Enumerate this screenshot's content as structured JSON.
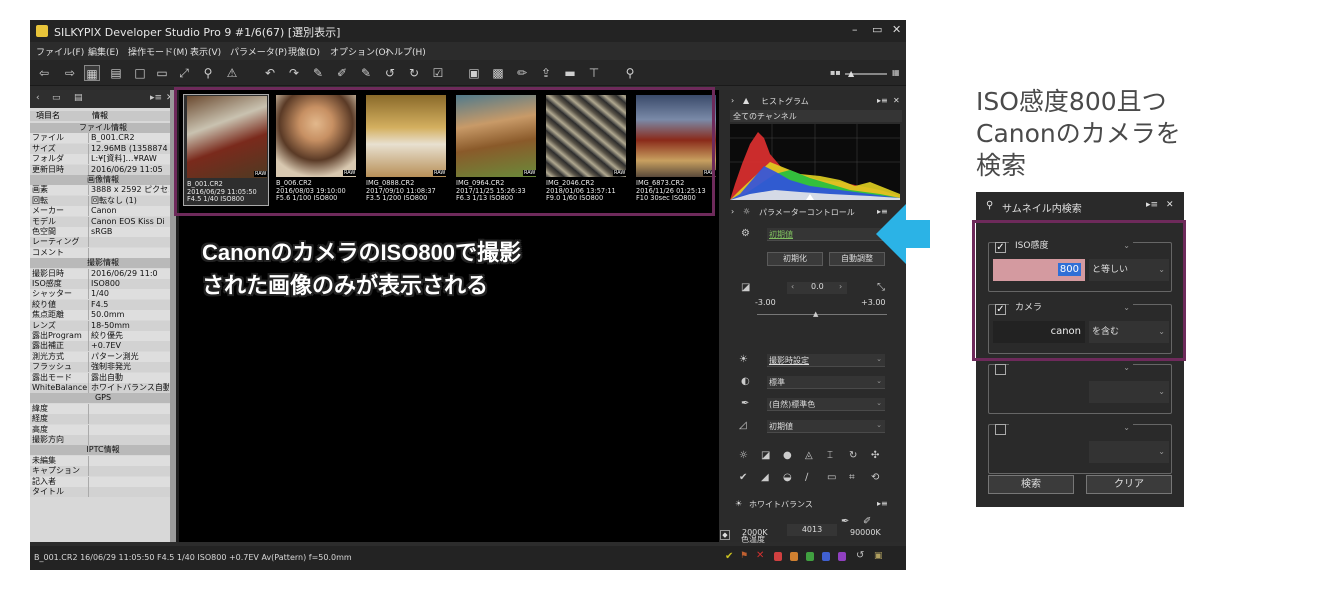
{
  "app": {
    "title": "SILKYPIX Developer Studio Pro 9   #1/6(67) [選別表示]",
    "menu": [
      "ファイル(F)",
      "編集(E)",
      "操作モード(M)",
      "表示(V)",
      "パラメータ(P)",
      "現像(D)",
      "オプション(O)",
      "ヘルプ(H)"
    ]
  },
  "left_panel": {
    "col_key": "項目名",
    "col_val": "情報",
    "sections": {
      "file": "ファイル情報",
      "image": "画像情報",
      "shooting": "撮影情報",
      "gps": "GPS",
      "iptc": "IPTC情報"
    },
    "file_rows": [
      {
        "k": "ファイル",
        "v": "B_001.CR2"
      },
      {
        "k": "サイズ",
        "v": "12.96MB (1358874"
      },
      {
        "k": "フォルダ",
        "v": "L:¥[資料]…¥RAW"
      },
      {
        "k": "更新日時",
        "v": "2016/06/29 11:05"
      }
    ],
    "image_rows": [
      {
        "k": "画素",
        "v": "3888 x 2592 ピクセル"
      },
      {
        "k": "回転",
        "v": "回転なし (1)"
      },
      {
        "k": "メーカー",
        "v": "Canon"
      },
      {
        "k": "モデル",
        "v": "Canon EOS Kiss Di"
      },
      {
        "k": "色空間",
        "v": "sRGB"
      },
      {
        "k": "レーティング",
        "v": ""
      },
      {
        "k": "コメント",
        "v": ""
      }
    ],
    "shooting_rows": [
      {
        "k": "撮影日時",
        "v": "2016/06/29 11:0"
      },
      {
        "k": "ISO感度",
        "v": "ISO800"
      },
      {
        "k": "シャッター",
        "v": "1/40"
      },
      {
        "k": "絞り値",
        "v": "F4.5"
      },
      {
        "k": "焦点距離",
        "v": "50.0mm"
      },
      {
        "k": "レンズ",
        "v": "18-50mm"
      },
      {
        "k": "露出Program",
        "v": "絞り優先"
      },
      {
        "k": "露出補正",
        "v": "+0.7EV"
      },
      {
        "k": "測光方式",
        "v": "パターン測光"
      },
      {
        "k": "フラッシュ",
        "v": "強制非発光"
      },
      {
        "k": "露出モード",
        "v": "露出自動"
      },
      {
        "k": "WhiteBalance",
        "v": "ホワイトバランス自動"
      }
    ],
    "gps_rows": [
      {
        "k": "緯度",
        "v": ""
      },
      {
        "k": "経度",
        "v": ""
      },
      {
        "k": "高度",
        "v": ""
      },
      {
        "k": "撮影方向",
        "v": ""
      }
    ],
    "iptc_rows": [
      {
        "k": "未編集",
        "v": ""
      },
      {
        "k": "キャプション",
        "v": ""
      },
      {
        "k": "記入者",
        "v": ""
      },
      {
        "k": "タイトル",
        "v": ""
      }
    ]
  },
  "thumbnails": [
    {
      "l1": "B_001.CR2",
      "l2": "2016/06/29 11:05:50",
      "l3": "F4.5 1/40 ISO800",
      "raw": "RAW"
    },
    {
      "l1": "B_006.CR2",
      "l2": "2016/08/03 19:10:00",
      "l3": "F5.6 1/100 ISO800",
      "raw": "RAW"
    },
    {
      "l1": "IMG_0888.CR2",
      "l2": "2017/09/10 11:08:37",
      "l3": "F3.5 1/200 ISO800",
      "raw": "RAW"
    },
    {
      "l1": "IMG_0964.CR2",
      "l2": "2017/11/25 15:26:33",
      "l3": "F6.3 1/13 ISO800",
      "raw": "RAW"
    },
    {
      "l1": "IMG_2046.CR2",
      "l2": "2018/01/06 13:57:11",
      "l3": "F9.0 1/60 ISO800",
      "raw": "RAW"
    },
    {
      "l1": "IMG_6873.CR2",
      "l2": "2016/11/26 01:25:13",
      "l3": "F10 30sec ISO800",
      "raw": "RAW"
    }
  ],
  "overlay_text": {
    "line1": "CanonのカメラのISO800で撮影",
    "line2": "された画像のみが表示される"
  },
  "right_panel": {
    "histogram_title": "ヒストグラム",
    "channel": "全てのチャンネル",
    "param_title": "パラメーターコントロール",
    "preset": "初期値",
    "btn_init": "初期化",
    "btn_auto": "自動調整",
    "exposure": {
      "value": "0.0",
      "min": "-3.00",
      "max": "+3.00"
    },
    "wb_setting": "撮影時設定",
    "tone": "標準",
    "color": "(自然)標準色",
    "sharp": "初期値",
    "wb_title": "ホワイトバランス",
    "color_temp_label": "色温度",
    "temp_value": "4013",
    "temp_min": "2000K",
    "temp_max": "90000K"
  },
  "statusbar": {
    "text": "B_001.CR2 16/06/29 11:05:50 F4.5 1/40 ISO800 +0.7EV Av(Pattern) f=50.0mm"
  },
  "heading": {
    "line1": "ISO感度800且つ",
    "line2": "Canonのカメラを",
    "line3": "検索"
  },
  "search_dialog": {
    "title": "サムネイル内検索",
    "cond1": {
      "label": "ISO感度",
      "value": "800",
      "op": "と等しい"
    },
    "cond2": {
      "label": "カメラ",
      "value": "canon",
      "op": "を含む"
    },
    "btn_search": "検索",
    "btn_clear": "クリア"
  },
  "colors": {
    "accent_frame": "#6e2a5b",
    "arrow": "#2bb3e6",
    "iso_highlight": "#d49aa0"
  }
}
